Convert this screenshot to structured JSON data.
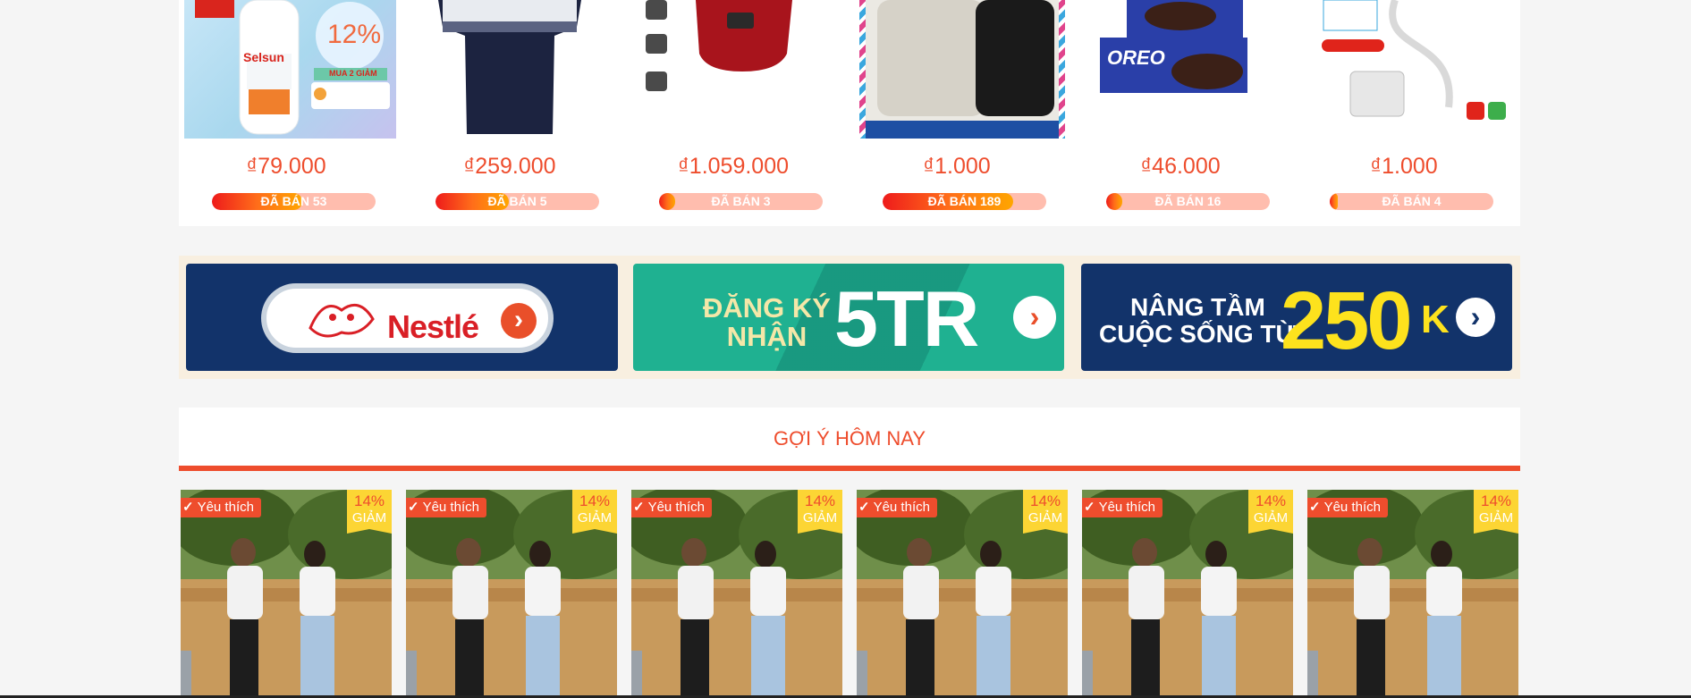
{
  "flash_sale": {
    "items": [
      {
        "price": "₫79.000",
        "sold": "ĐÃ BÁN 53",
        "sold_fill": 0.55,
        "image": "selsun-shampoo-image"
      },
      {
        "price": "₫259.000",
        "sold": "ĐÃ BÁN 5",
        "sold_fill": 0.45,
        "image": "polo-shirt-image"
      },
      {
        "price": "₫1.059.000",
        "sold": "ĐÃ BÁN 3",
        "sold_fill": 0.1,
        "image": "rice-cooker-image"
      },
      {
        "price": "₫1.000",
        "sold": "ĐÃ BÁN 189",
        "sold_fill": 0.8,
        "image": "iphone-case-image"
      },
      {
        "price": "₫46.000",
        "sold": "ĐÃ BÁN 16",
        "sold_fill": 0.1,
        "image": "oreo-image"
      },
      {
        "price": "₫1.000",
        "sold": "ĐÃ BÁN 4",
        "sold_fill": 0.05,
        "image": "usb-cable-image"
      }
    ],
    "selsun": {
      "brand": "Selsun",
      "badge": "12%",
      "promo": "MUA 2 GIẢM"
    },
    "oreo": {
      "brand": "OREO"
    }
  },
  "banners": {
    "nestle": {
      "word": "Nestlé"
    },
    "dangky": {
      "line1": "ĐĂNG KÝ",
      "line2": "NHẬN",
      "big": "5TR"
    },
    "nangtam": {
      "line1": "NÂNG TẦM",
      "line2": "CUỘC SỐNG TỪ",
      "big": "250",
      "suffix": "K"
    }
  },
  "recommend": {
    "title": "GỢI Ý HÔM NAY",
    "cards": [
      {
        "fav": "Yêu thích",
        "discount": "14%",
        "discount_label": "GIẢM"
      },
      {
        "fav": "Yêu thích",
        "discount": "14%",
        "discount_label": "GIẢM"
      },
      {
        "fav": "Yêu thích",
        "discount": "14%",
        "discount_label": "GIẢM"
      },
      {
        "fav": "Yêu thích",
        "discount": "14%",
        "discount_label": "GIẢM"
      },
      {
        "fav": "Yêu thích",
        "discount": "14%",
        "discount_label": "GIẢM"
      },
      {
        "fav": "Yêu thích",
        "discount": "14%",
        "discount_label": "GIẢM"
      }
    ]
  },
  "colors": {
    "accent": "#ee4d2d",
    "discount_bg": "#fcd534",
    "banner_navy": "#12336a",
    "banner_teal": "#1fb191",
    "sold_bar_bg": "#ffbdae"
  }
}
